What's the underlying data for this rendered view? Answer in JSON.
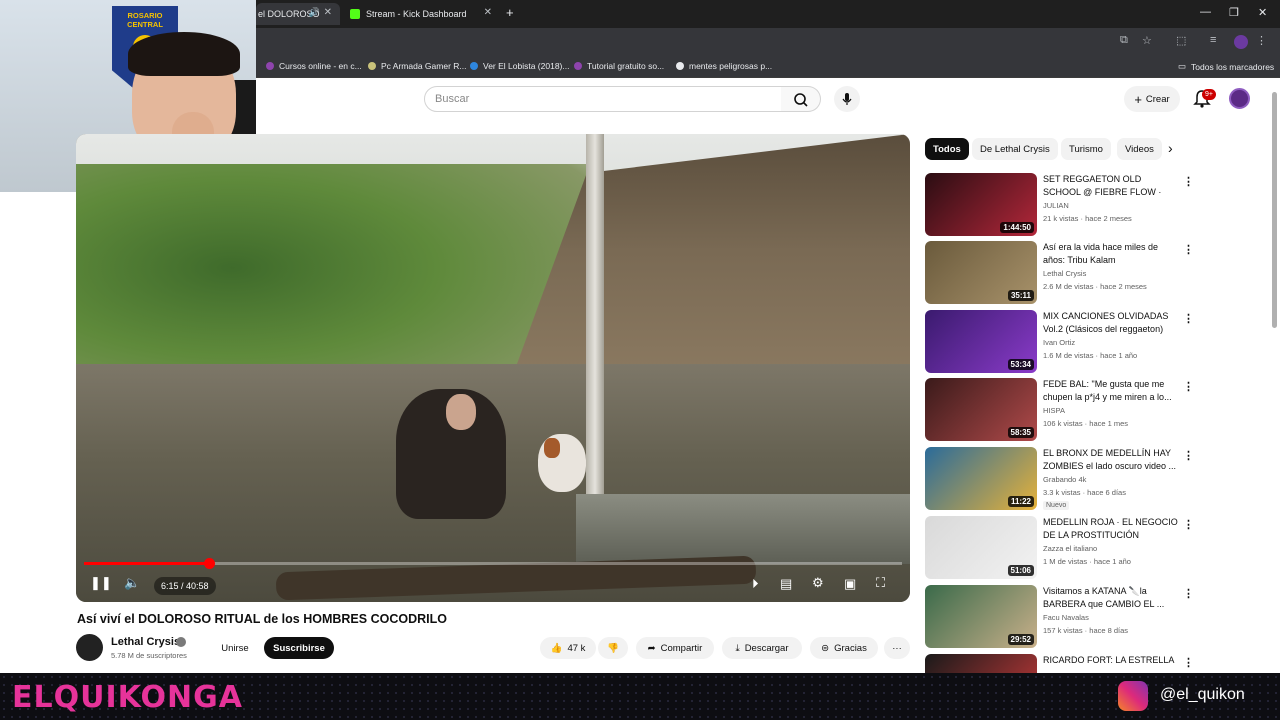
{
  "browser": {
    "tabs": [
      {
        "label": "el DOLOROSO"
      },
      {
        "label": "Stream - Kick Dashboard"
      }
    ],
    "bookmarks": [
      {
        "label": "Cursos online - en c...",
        "color": "#8e44ad"
      },
      {
        "label": "Pc Armada Gamer R...",
        "color": "#c9c27a"
      },
      {
        "label": "Ver El Lobista (2018)...",
        "color": "#2e86de"
      },
      {
        "label": "Tutorial gratuito so...",
        "color": "#8e44ad"
      },
      {
        "label": "mentes peligrosas p...",
        "color": "#e8eaed"
      }
    ],
    "all_bookmarks": "Todos los marcadores"
  },
  "webcam": {
    "pennant_top": "ROSARIO",
    "pennant_bottom": "CENTRAL"
  },
  "header": {
    "search_placeholder": "Buscar",
    "create_label": "Crear",
    "notif_count": "9+"
  },
  "video": {
    "time": "6:15 / 40:58",
    "progress": 0.1525,
    "title": "Así viví el DOLOROSO RITUAL de los HOMBRES COCODRILO",
    "channel": "Lethal Crysis",
    "subs": "5.78 M de suscriptores",
    "join": "Unirse",
    "subscribe": "Suscribirse",
    "likes": "47 k",
    "share": "Compartir",
    "download": "Descargar",
    "thanks": "Gracias"
  },
  "chips": [
    "Todos",
    "De Lethal Crysis",
    "Turismo",
    "Videos"
  ],
  "recommendations": [
    {
      "title": "SET REGGAETON OLD SCHOOL @ FIEBRE FLOW · JULIAN VE",
      "channel": "JULIAN",
      "meta": "21 k vistas · hace 2 meses",
      "duration": "1:44:50",
      "colors": [
        "#2a0d12",
        "#b3273a"
      ],
      "badge": ""
    },
    {
      "title": "Así era la vida hace miles de años: Tribu Kalam",
      "channel": "Lethal Crysis",
      "meta": "2.6 M de vistas · hace 2 meses",
      "duration": "35:11",
      "colors": [
        "#6a5a3c",
        "#a8926a"
      ],
      "badge": ""
    },
    {
      "title": "MIX CANCIONES OLVIDADAS Vol.2 (Clásicos del reggaeton)",
      "channel": "Ivan Ortiz",
      "meta": "1.6 M de vistas · hace 1 año",
      "duration": "53:34",
      "colors": [
        "#3a1a6e",
        "#8a3bc9"
      ],
      "badge": ""
    },
    {
      "title": "FEDE BAL: \"Me gusta que me chupen la p*j4 y me miren a lo...",
      "channel": "HISPA",
      "meta": "106 k vistas · hace 1 mes",
      "duration": "58:35",
      "colors": [
        "#3a1a1a",
        "#b04a4a"
      ],
      "badge": ""
    },
    {
      "title": "EL BRONX DE MEDELLÍN HAY ZOMBIES el lado oscuro video ...",
      "channel": "Grabando 4k",
      "meta": "3.3 k vistas · hace 6 días",
      "duration": "11:22",
      "colors": [
        "#2a6b9a",
        "#e6b23a"
      ],
      "badge": "Nuevo"
    },
    {
      "title": "MEDELLIN ROJA · EL NEGOCIO DE LA PROSTITUCIÓN",
      "channel": "Zazza el italiano",
      "meta": "1 M de vistas · hace 1 año",
      "duration": "51:06",
      "colors": [
        "#d9d9d9",
        "#f2f2f2"
      ],
      "badge": ""
    },
    {
      "title": "Visitamos a KATANA 🔪la BARBERA que CAMBIO EL ...",
      "channel": "Facu Navalas",
      "meta": "157 k vistas · hace 8 días",
      "duration": "29:52",
      "colors": [
        "#3a6a4a",
        "#c9b08a"
      ],
      "badge": ""
    },
    {
      "title": "RICARDO FORT: LA ESTRELLA",
      "channel": "",
      "meta": "",
      "duration": "",
      "colors": [
        "#1a1a1a",
        "#c93a3a"
      ],
      "badge": ""
    }
  ],
  "overlay": {
    "name": "ELQUIKONGA",
    "handle": "@el_quikon"
  }
}
